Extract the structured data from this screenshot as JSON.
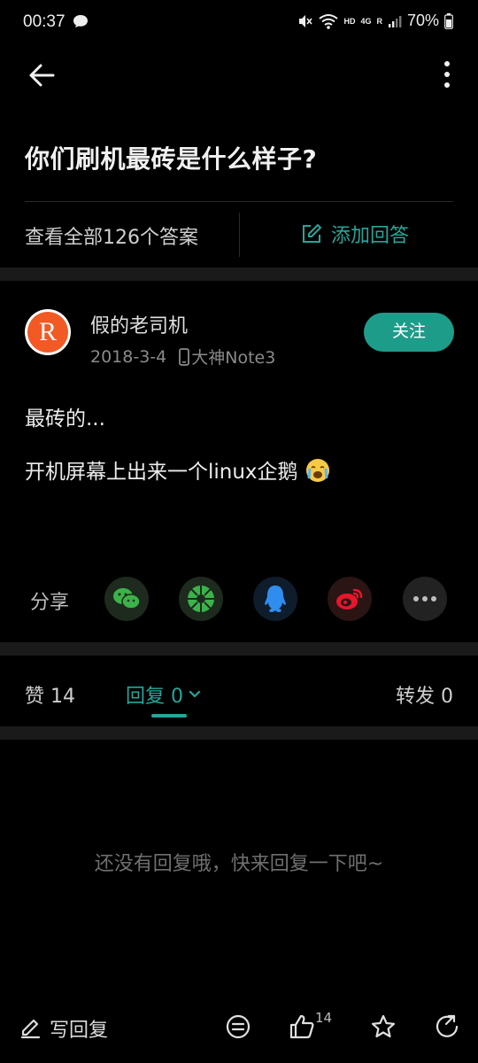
{
  "status_bar": {
    "time": "00:37",
    "hd": "HD",
    "network": "4G",
    "roaming": "R",
    "battery": "70%"
  },
  "header": {
    "back_icon": "arrow-left-icon",
    "more_icon": "more-vertical-icon"
  },
  "question": {
    "title": "你们刷机最砖是什么样子?",
    "all_answers": "查看全部126个答案",
    "add_answer": "添加回答"
  },
  "answer": {
    "avatar_letter": "R",
    "author": "假的老司机",
    "date": "2018-3-4",
    "device": "大神Note3",
    "follow": "关注",
    "lines": [
      "最砖的...",
      "开机屏幕上出来一个linux企鹅"
    ]
  },
  "share": {
    "label": "分享",
    "targets": [
      "wechat-icon",
      "moments-icon",
      "qq-icon",
      "weibo-icon",
      "more-icon"
    ]
  },
  "tabs": {
    "likes": "赞 14",
    "replies": "回复 0",
    "reposts": "转发 0"
  },
  "empty_message": "还没有回复哦，快来回复一下吧~",
  "bottom_bar": {
    "write_reply": "写回复",
    "like_count": "14"
  },
  "colors": {
    "accent": "#26a69a",
    "follow_bg": "#1e9c8a",
    "background": "#000000"
  }
}
